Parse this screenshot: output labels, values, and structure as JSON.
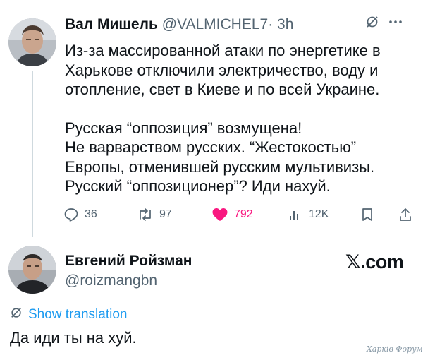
{
  "tweet1": {
    "author_name": "Вал Мишель",
    "handle": "@VALMICHEL7",
    "separator": "·",
    "time": "3h",
    "text_lines": [
      "Из-за массированной атаки по энергетике в",
      "Харькове отключили электричество, воду и",
      "отопление, свет в Киеве и по всей Украине.",
      "",
      "Русская “оппозиция” возмущена!",
      "Не варварством русских. “Жестокостью”",
      "Европы, отменившей русским мультивизы.",
      "Русский “оппозиционер”? Иди нахуй."
    ],
    "replies": "36",
    "reposts": "97",
    "likes": "792",
    "views": "12K",
    "menu_icons": [
      "grok-icon",
      "more-icon"
    ],
    "colors": {
      "like": "#f91880",
      "muted": "#536471"
    }
  },
  "tweet2": {
    "author_name": "Евгений Ройзман",
    "handle": "@roizmangbn",
    "brand": "𝕏.com",
    "show_translation": "Show translation",
    "text": "Да иди ты на хуй."
  },
  "watermark": "Харків Форум",
  "colors": {
    "link": "#1d9bf0",
    "text": "#0f1419",
    "thread_line": "#cfd9de"
  }
}
